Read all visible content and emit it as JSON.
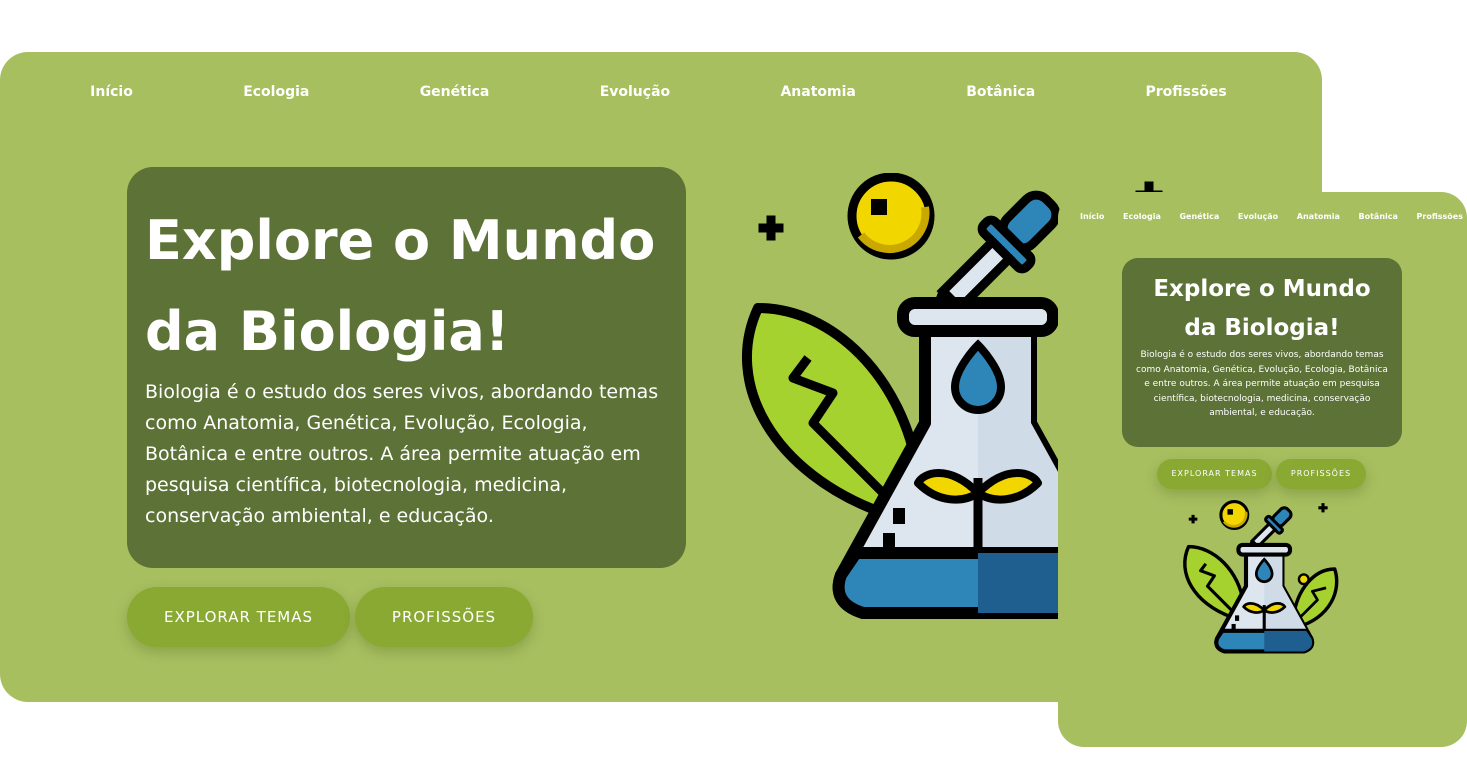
{
  "nav": [
    "Início",
    "Ecologia",
    "Genética",
    "Evolução",
    "Anatomia",
    "Botânica",
    "Profissões"
  ],
  "hero": {
    "title_line1": "Explore o Mundo",
    "title_line2": "da Biologia!",
    "description": "Biologia é o estudo dos seres vivos, abordando temas como Anatomia, Genética, Evolução, Ecologia, Botânica e entre outros. A área permite atuação em pesquisa científica, biotecnologia, medicina, conservação ambiental, e educação."
  },
  "buttons": {
    "explore": "EXPLORAR TEMAS",
    "careers": "PROFISSÕES"
  },
  "illustration": {
    "icon": "biology-flask-icon"
  },
  "colors": {
    "page_bg": "#ffffff",
    "panel_bg": "#a7bf5f",
    "card_bg": "#5c7236",
    "button_bg": "#8aa933",
    "leaf_green": "#a6d22f",
    "liquid_blue": "#2e86b8",
    "accent_yellow": "#f2d600"
  }
}
